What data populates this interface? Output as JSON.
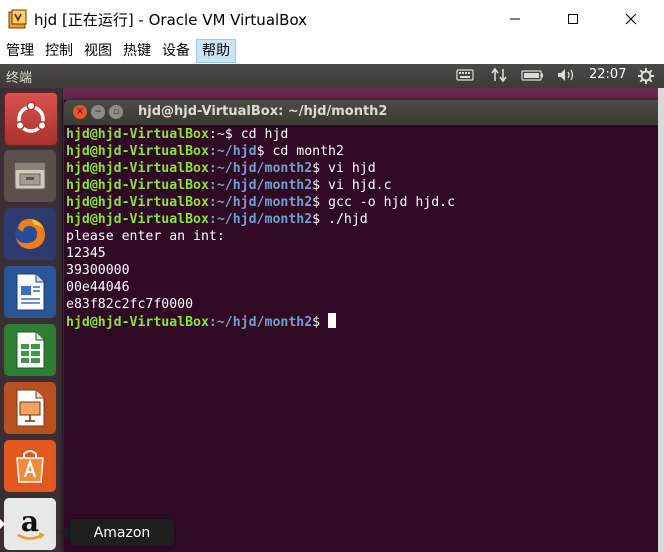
{
  "window": {
    "title": "hjd [正在运行] - Oracle VM VirtualBox"
  },
  "menubar": {
    "items": [
      "管理",
      "控制",
      "视图",
      "热键",
      "设备",
      "帮助"
    ],
    "active_index": 5
  },
  "ubuntu_panel": {
    "app_title": "终端",
    "clock": "22:07"
  },
  "launcher": {
    "items": [
      {
        "icon": "ubuntu-dash-icon"
      },
      {
        "icon": "files-icon"
      },
      {
        "icon": "firefox-icon"
      },
      {
        "icon": "libreoffice-writer-icon"
      },
      {
        "icon": "libreoffice-calc-icon"
      },
      {
        "icon": "libreoffice-impress-icon"
      },
      {
        "icon": "ubuntu-software-icon"
      },
      {
        "icon": "amazon-icon"
      }
    ],
    "tooltip": "Amazon"
  },
  "terminal": {
    "title": "hjd@hjd-VirtualBox: ~/hjd/month2",
    "lines": [
      {
        "user": "hjd@hjd-VirtualBox",
        "path": ":~",
        "cmd": "$ cd hjd"
      },
      {
        "user": "hjd@hjd-VirtualBox",
        "path": ":~/hjd",
        "cmd": "$ cd month2"
      },
      {
        "user": "hjd@hjd-VirtualBox",
        "path": ":~/hjd/month2",
        "cmd": "$ vi hjd"
      },
      {
        "user": "hjd@hjd-VirtualBox",
        "path": ":~/hjd/month2",
        "cmd": "$ vi hjd.c"
      },
      {
        "user": "hjd@hjd-VirtualBox",
        "path": ":~/hjd/month2",
        "cmd": "$ gcc -o hjd hjd.c"
      },
      {
        "user": "hjd@hjd-VirtualBox",
        "path": ":~/hjd/month2",
        "cmd": "$ ./hjd"
      }
    ],
    "output": [
      "please enter an int:",
      "12345",
      "39300000",
      "00e44046",
      "e83f82c2fc7f0000"
    ],
    "final_prompt": {
      "user": "hjd@hjd-VirtualBox",
      "path": ":~/hjd/month2",
      "cmd": "$ "
    }
  }
}
